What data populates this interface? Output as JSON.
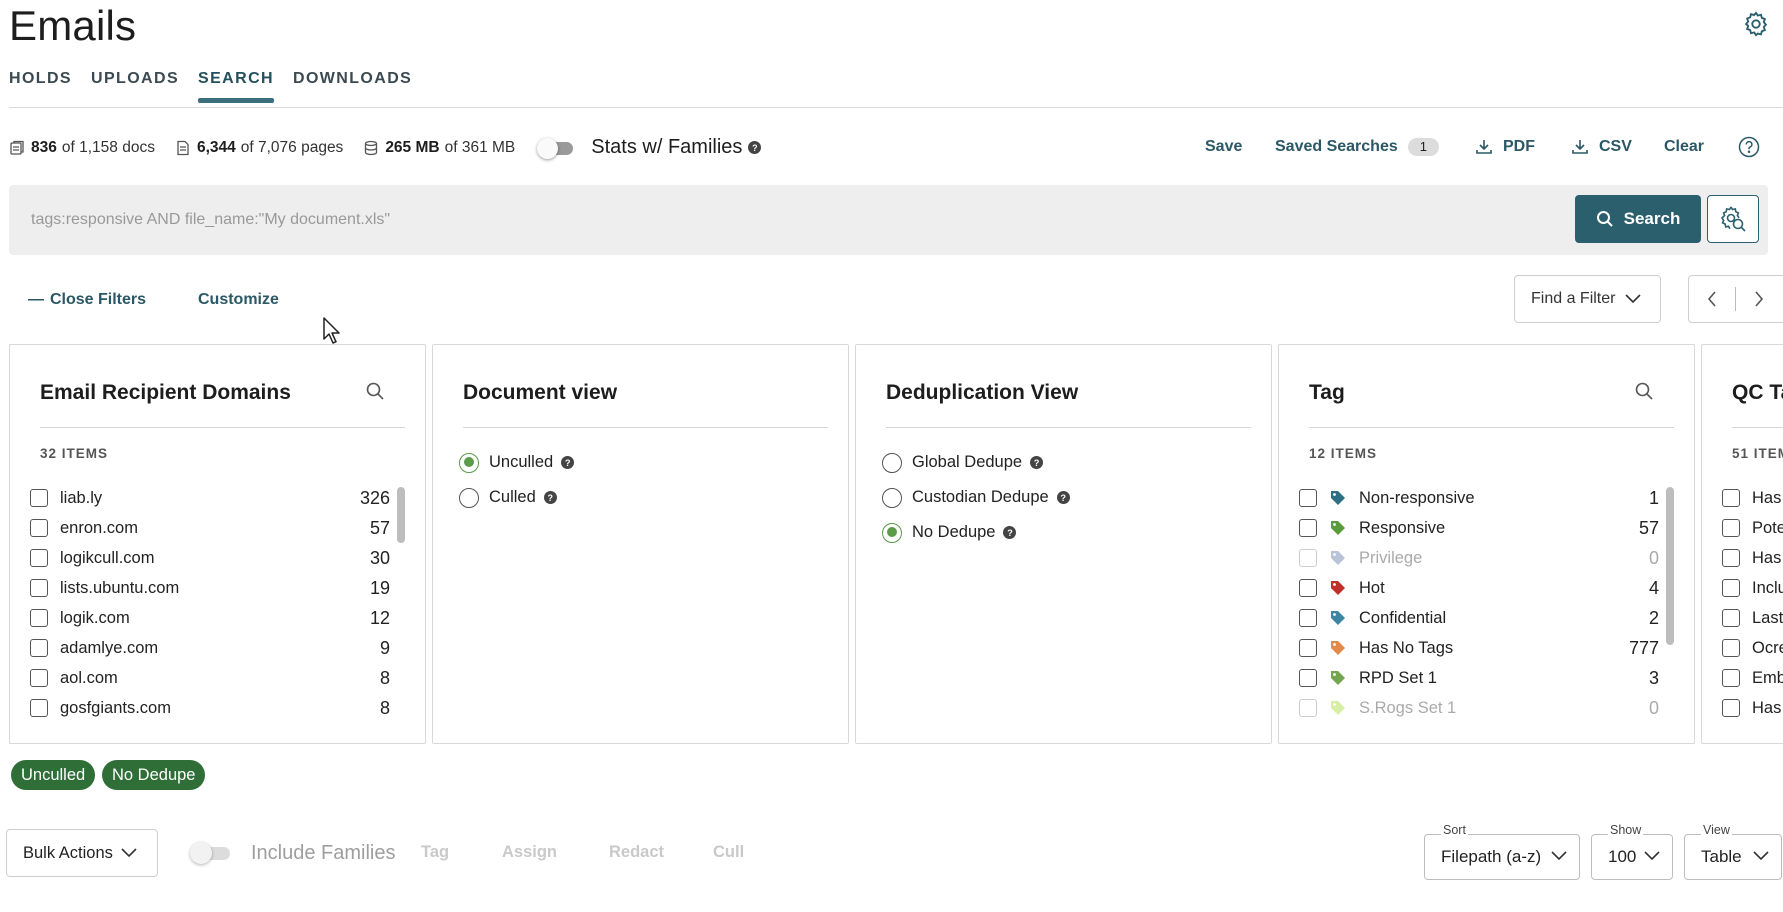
{
  "header": {
    "title": "Emails"
  },
  "tabs": [
    {
      "label": "HOLDS",
      "active": false
    },
    {
      "label": "UPLOADS",
      "active": false
    },
    {
      "label": "SEARCH",
      "active": true
    },
    {
      "label": "DOWNLOADS",
      "active": false
    }
  ],
  "stats": {
    "docs": {
      "bold": "836",
      "rest": "of 1,158 docs"
    },
    "pages": {
      "bold": "6,344",
      "rest": "of 7,076 pages"
    },
    "size": {
      "bold": "265 MB",
      "rest": "of 361 MB"
    },
    "families_label": "Stats w/ Families",
    "families_toggle": false
  },
  "actions": {
    "save": "Save",
    "saved_searches": "Saved Searches",
    "saved_searches_count": "1",
    "pdf": "PDF",
    "csv": "CSV",
    "clear": "Clear"
  },
  "search": {
    "placeholder": "tags:responsive AND file_name:\"My document.xls\"",
    "button_label": "Search"
  },
  "filters": {
    "close_label": "Close Filters",
    "customize_label": "Customize",
    "find_label": "Find a Filter"
  },
  "panels": {
    "domains": {
      "title": "Email Recipient Domains",
      "count_label": "32 ITEMS",
      "items": [
        {
          "label": "liab.ly",
          "count": "326"
        },
        {
          "label": "enron.com",
          "count": "57"
        },
        {
          "label": "logikcull.com",
          "count": "30"
        },
        {
          "label": "lists.ubuntu.com",
          "count": "19"
        },
        {
          "label": "logik.com",
          "count": "12"
        },
        {
          "label": "adamlye.com",
          "count": "9"
        },
        {
          "label": "aol.com",
          "count": "8"
        },
        {
          "label": "gosfgiants.com",
          "count": "8"
        }
      ]
    },
    "document_view": {
      "title": "Document view",
      "options": [
        {
          "label": "Unculled",
          "selected": true
        },
        {
          "label": "Culled",
          "selected": false
        }
      ]
    },
    "dedupe_view": {
      "title": "Deduplication View",
      "options": [
        {
          "label": "Global Dedupe",
          "selected": false
        },
        {
          "label": "Custodian Dedupe",
          "selected": false
        },
        {
          "label": "No Dedupe",
          "selected": true
        }
      ]
    },
    "tag": {
      "title": "Tag",
      "count_label": "12 ITEMS",
      "items": [
        {
          "label": "Non-responsive",
          "count": "1",
          "color": "#2e6f85",
          "disabled": false
        },
        {
          "label": "Responsive",
          "count": "57",
          "color": "#5a9b3c",
          "disabled": false
        },
        {
          "label": "Privilege",
          "count": "0",
          "color": "#7f93b8",
          "disabled": true
        },
        {
          "label": "Hot",
          "count": "4",
          "color": "#c0302b",
          "disabled": false
        },
        {
          "label": "Confidential",
          "count": "2",
          "color": "#3e86a3",
          "disabled": false
        },
        {
          "label": "Has No Tags",
          "count": "777",
          "color": "#e28a4c",
          "disabled": false
        },
        {
          "label": "RPD Set 1",
          "count": "3",
          "color": "#74a651",
          "disabled": false
        },
        {
          "label": "S.Rogs Set 1",
          "count": "0",
          "color": "#b7e35a",
          "disabled": true
        }
      ]
    },
    "qc_tag": {
      "title": "QC Ta",
      "count_label": "51 ITEM",
      "items": [
        "Has",
        "Pote",
        "Has",
        "Inclu",
        "Last",
        "Ocre",
        "Emb",
        "Has"
      ]
    }
  },
  "chips": [
    "Unculled",
    "No Dedupe"
  ],
  "bottom": {
    "bulk_actions": "Bulk Actions",
    "include_families": "Include Families",
    "tag": "Tag",
    "assign": "Assign",
    "redact": "Redact",
    "cull": "Cull",
    "sort_label": "Sort",
    "sort_value": "Filepath (a-z)",
    "show_label": "Show",
    "show_value": "100",
    "view_label": "View",
    "view_value": "Table"
  }
}
